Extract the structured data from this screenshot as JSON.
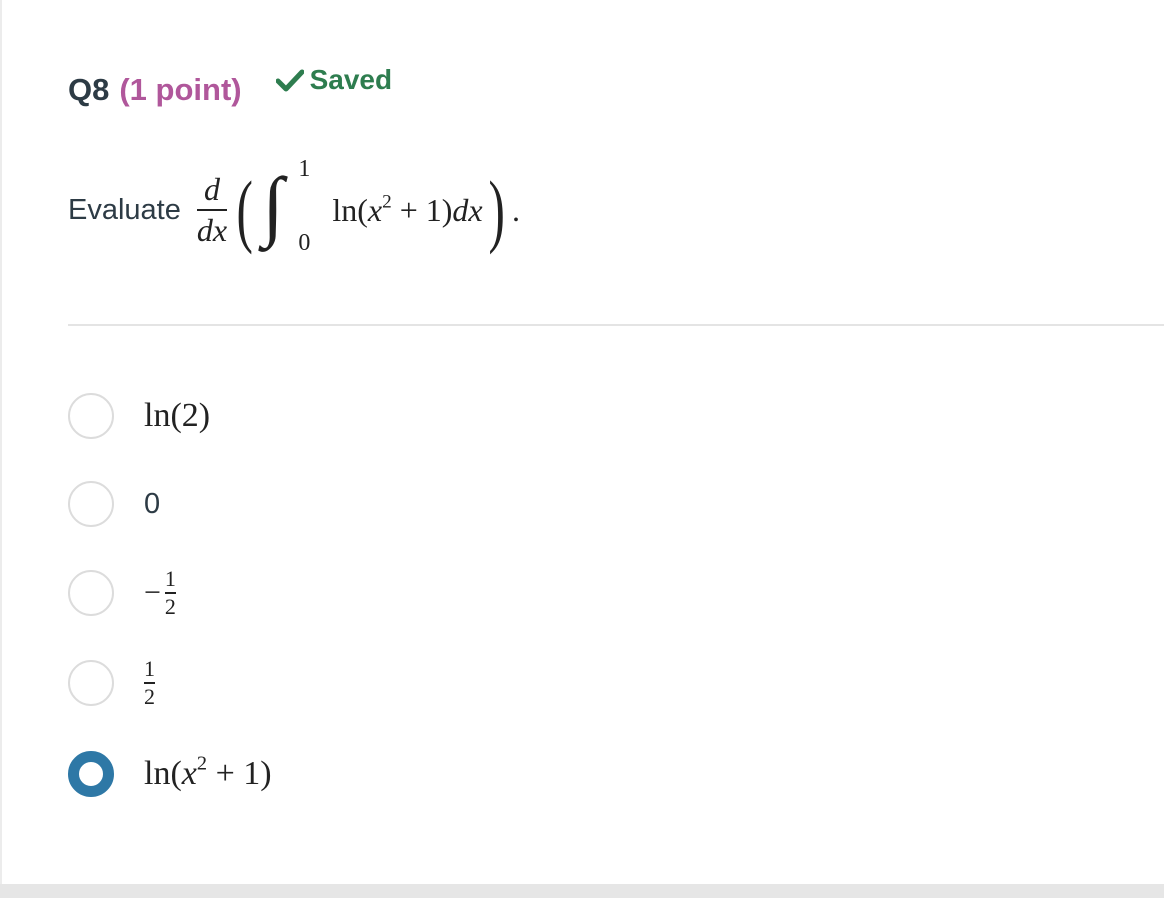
{
  "question": {
    "number": "Q8",
    "points": "(1 point)",
    "status_icon": "checkmark-icon",
    "status_label": "Saved",
    "prompt": "Evaluate",
    "expression": {
      "outer_num": "d",
      "outer_den": "dx",
      "upper_limit": "1",
      "lower_limit": "0",
      "integrand_fn": "ln(",
      "integrand_var": "x",
      "integrand_exp": "2",
      "integrand_rest": " + 1)",
      "differential": "dx",
      "period": "."
    }
  },
  "options": [
    {
      "label": "ln(2)",
      "selected": false
    },
    {
      "label": "0",
      "selected": false
    },
    {
      "label_sign": "−",
      "label_num": "1",
      "label_den": "2",
      "selected": false
    },
    {
      "label_num": "1",
      "label_den": "2",
      "selected": false
    },
    {
      "label_fn": "ln(",
      "label_var": "x",
      "label_exp": "2",
      "label_rest": " + 1)",
      "selected": true
    }
  ],
  "colors": {
    "points": "#b0579b",
    "saved": "#2e7d4f",
    "radio_selected": "#2e78a6"
  }
}
